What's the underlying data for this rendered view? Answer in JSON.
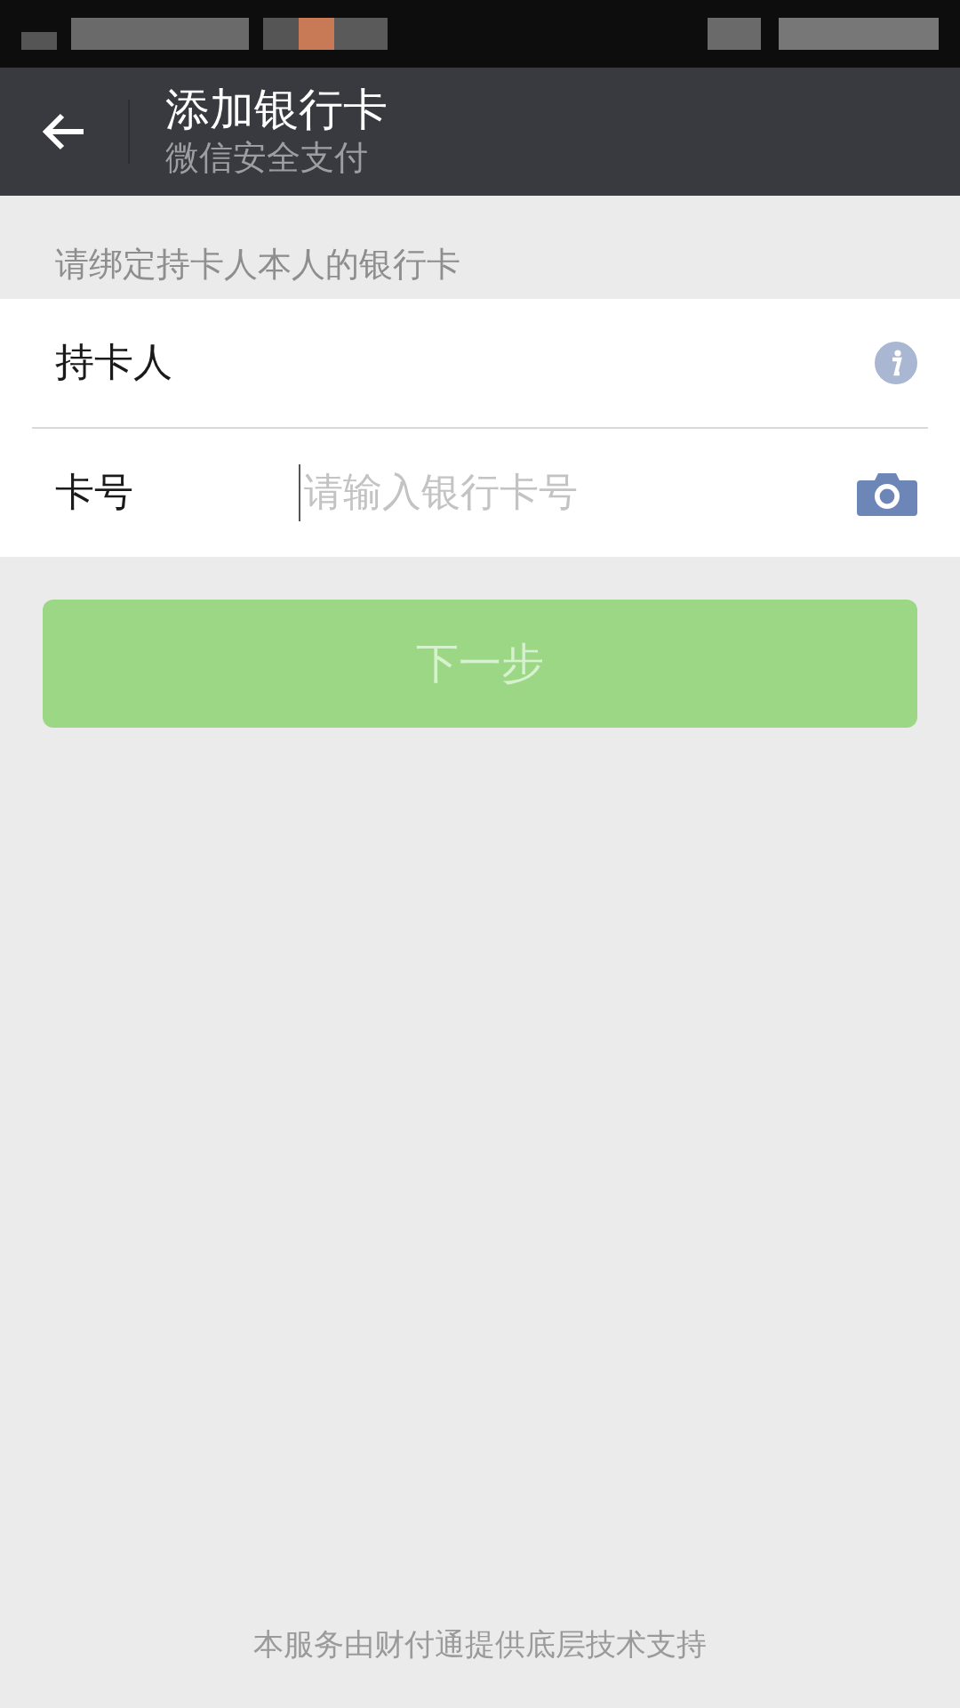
{
  "header": {
    "title": "添加银行卡",
    "subtitle": "微信安全支付"
  },
  "hint": "请绑定持卡人本人的银行卡",
  "fields": [
    {
      "kind": "info",
      "label": "持卡人"
    },
    {
      "kind": "camera",
      "label": "卡号",
      "placeholder": "请输入银行卡号",
      "focused": true
    }
  ],
  "next_button": {
    "label": "下一步",
    "disabled": true
  },
  "footer": "本服务由财付通提供底层技术支持"
}
